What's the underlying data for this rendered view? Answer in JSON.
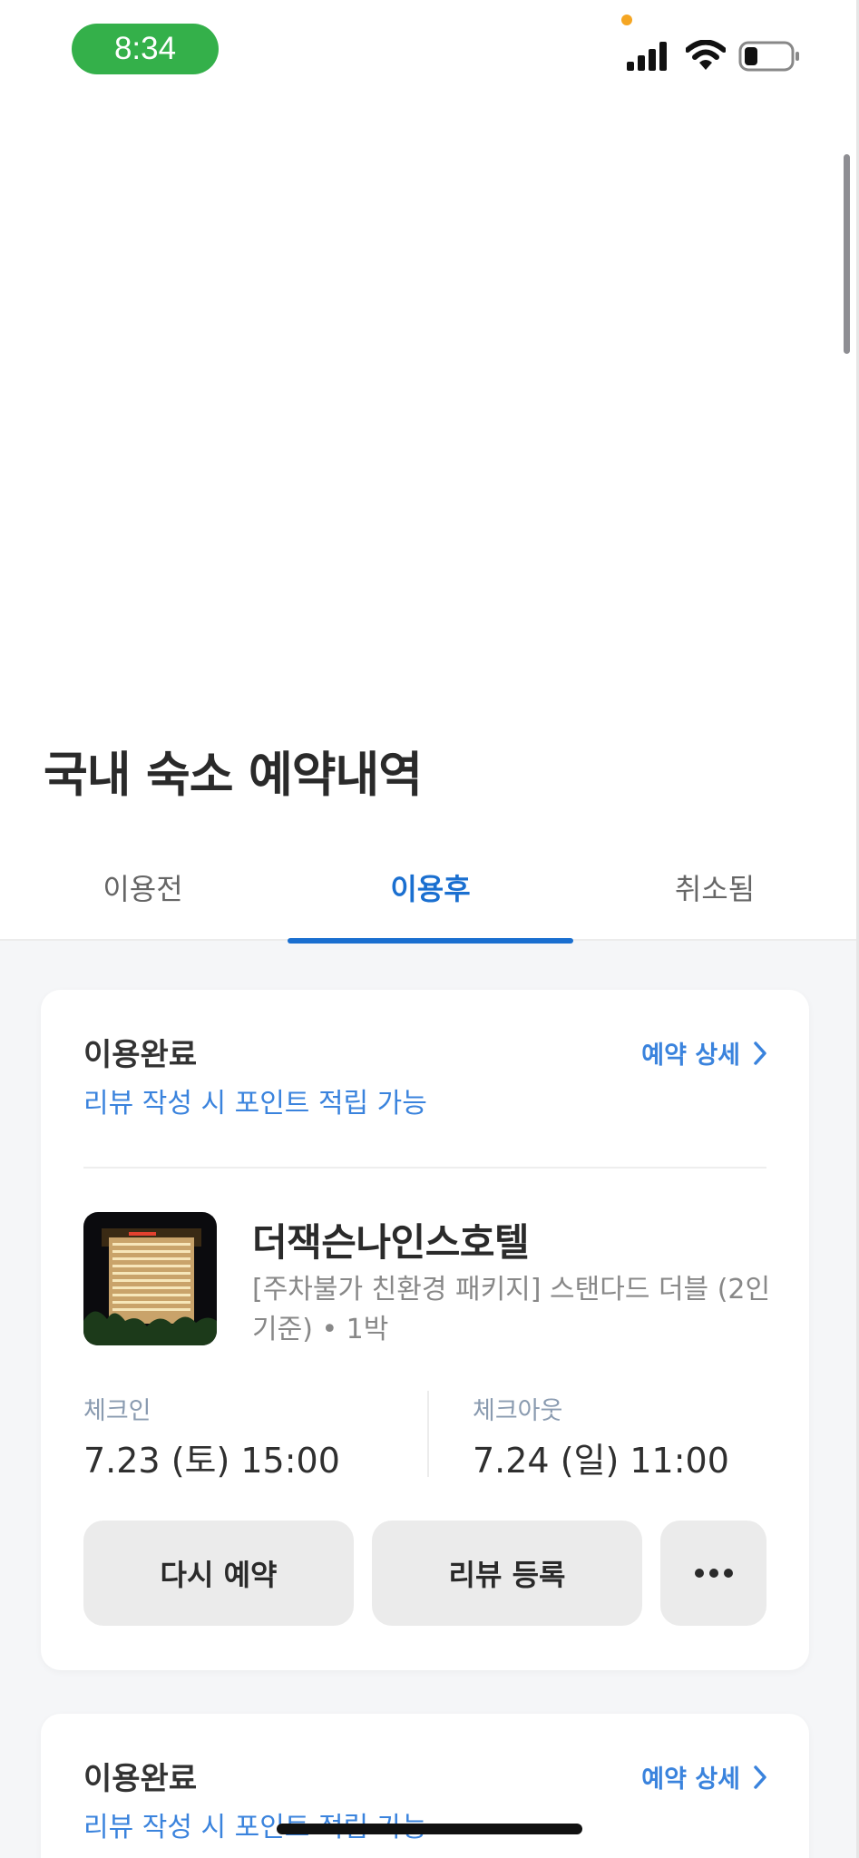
{
  "status_bar": {
    "time": "8:34"
  },
  "page": {
    "title": "국내 숙소 예약내역"
  },
  "tabs": [
    {
      "label": "이용전"
    },
    {
      "label": "이용후",
      "active": true
    },
    {
      "label": "취소됨"
    }
  ],
  "colors": {
    "accent": "#1a6fd0",
    "link": "#3a83dd",
    "status_pill": "#34b04a"
  },
  "bookings": [
    {
      "status": "이용완료",
      "status_sub": "리뷰 작성 시 포인트 적립 가능",
      "detail_link": "예약 상세",
      "hotel_name": "더잭슨나인스호텔",
      "room_desc": "[주차불가 친환경 패키지] 스탠다드 더블 (2인 기준) • 1박",
      "checkin_label": "체크인",
      "checkin_value": "7.23 (토) 15:00",
      "checkout_label": "체크아웃",
      "checkout_value": "7.24 (일) 11:00",
      "rebook_label": "다시 예약",
      "review_label": "리뷰 등록",
      "more_icon": "more-horizontal-icon"
    },
    {
      "status": "이용완료",
      "status_sub": "리뷰 작성 시 포인트 적립 가능",
      "detail_link": "예약 상세"
    }
  ]
}
